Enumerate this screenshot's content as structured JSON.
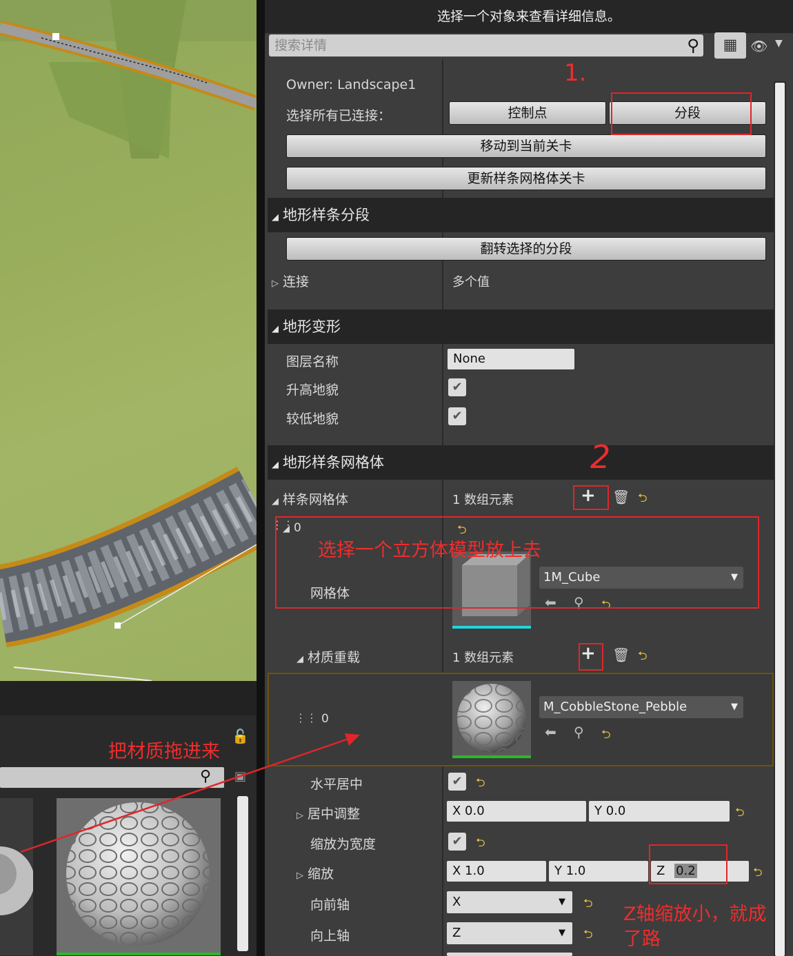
{
  "panel": {
    "title": "选择一个对象来查看详细信息。",
    "search_placeholder": "搜索详情",
    "owner": "Owner: Landscape1",
    "select_connected_label": "选择所有已连接：",
    "btn_control_points": "控制点",
    "btn_segments": "分段",
    "btn_move_to_level": "移动到当前关卡",
    "btn_update_level": "更新样条网格体关卡"
  },
  "segment_section": {
    "title": "地形样条分段",
    "btn_flip": "翻转选择的分段",
    "connections_label": "连接",
    "connections_value": "多个值"
  },
  "deform_section": {
    "title": "地形变形",
    "layer_name_label": "图层名称",
    "layer_name_value": "None",
    "raise_label": "升高地貌",
    "lower_label": "较低地貌"
  },
  "mesh_section": {
    "title": "地形样条网格体",
    "spline_meshes_label": "样条网格体",
    "spline_meshes_count": "1 数组元素",
    "element_index": "0",
    "mesh_label": "网格体",
    "mesh_value": "1M_Cube",
    "material_override_label": "材质重载",
    "material_override_count": "1 数组元素",
    "material_index": "0",
    "material_value": "M_CobbleStone_Pebble",
    "center_h_label": "水平居中",
    "center_adjust_label": "居中调整",
    "center_adjust_x": "X  0.0",
    "center_adjust_y": "Y  0.0",
    "scale_to_width_label": "缩放为宽度",
    "scale_label": "缩放",
    "scale_x": "X  1.0",
    "scale_y": "Y  1.0",
    "scale_z_axis": "Z",
    "scale_z_value": "0.2",
    "forward_axis_label": "向前轴",
    "forward_axis_value": "X",
    "up_axis_label": "向上轴",
    "up_axis_value": "Z"
  },
  "annotations": {
    "n1": "1.",
    "n2": "2",
    "choose_cube": "选择一个立方体模型放上去",
    "drag_material": "把材质拖进来",
    "z_scale_note_1": "Z轴缩放小，就成",
    "z_scale_note_2": "了路"
  },
  "colors": {
    "annotation_red": "#e0262a",
    "reset_yellow": "#e9c13a",
    "mesh_thumb_underline": "#1fd6e0",
    "material_thumb_underline": "#2ab82a",
    "highlight_row_border": "#6d5310"
  },
  "icons": [
    "search-icon",
    "grid-view-icon",
    "eye-icon",
    "plus-icon",
    "trash-icon",
    "reset-arrow-icon",
    "use-selected-arrow-icon",
    "browse-magnifier-icon",
    "lock-icon",
    "save-icon",
    "drag-handle-icon",
    "triangle-expanded-icon",
    "triangle-collapsed-icon"
  ]
}
